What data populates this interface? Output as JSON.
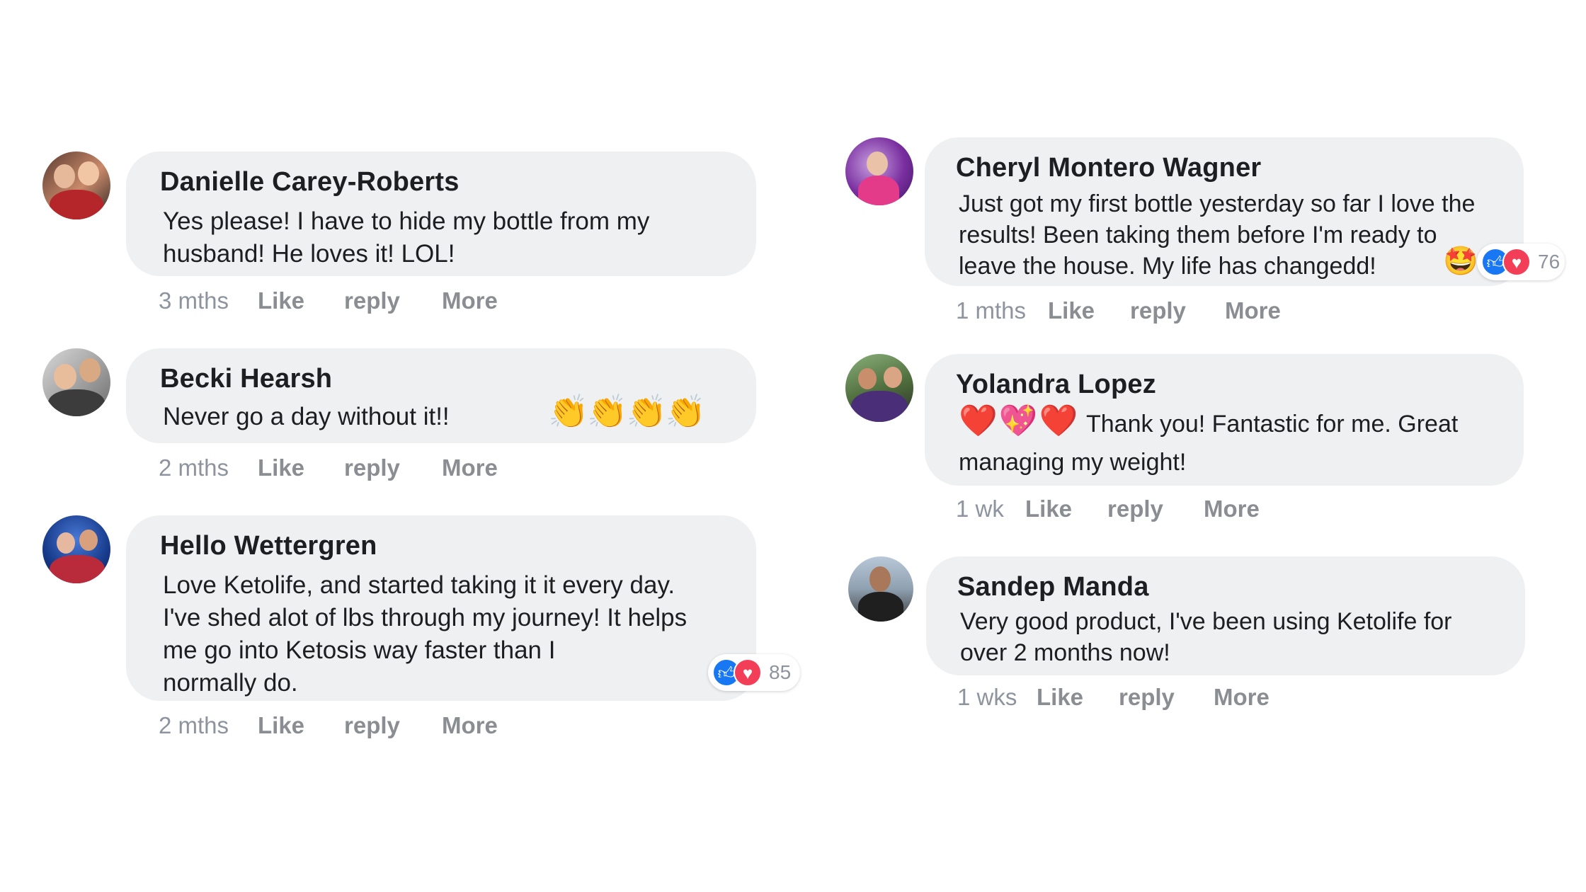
{
  "comments": [
    {
      "author": "Danielle Carey-Roberts",
      "lines": [
        "Yes please! I have to hide my bottle from my",
        "husband! He loves it! LOL!"
      ],
      "time": "3 mths",
      "like": "Like",
      "reply": "reply",
      "more": "More"
    },
    {
      "author": "Becki Hearsh",
      "lines": [
        "Never go a day without it!!"
      ],
      "emoji": "👏👏👏👏",
      "time": "2 mths",
      "like": "Like",
      "reply": "reply",
      "more": "More"
    },
    {
      "author": "Hello Wettergren",
      "lines": [
        "Love Ketolife, and started taking it it every day.",
        "I've shed alot of lbs through my journey! It helps",
        "me go into Ketosis way faster than I",
        "normally do."
      ],
      "reaction_count": "85",
      "time": "2 mths",
      "like": "Like",
      "reply": "reply",
      "more": "More"
    },
    {
      "author": "Cheryl Montero Wagner",
      "lines": [
        "Just got my first bottle yesterday so far I love the",
        "results! Been taking them before I'm ready to",
        "leave the house. My life has changedd!"
      ],
      "reaction_count": "76",
      "time": "1 mths",
      "like": "Like",
      "reply": "reply",
      "more": "More"
    },
    {
      "author": "Yolandra Lopez",
      "lines": [
        "Thank you! Fantastic for me. Great",
        "managing my weight!"
      ],
      "emoji": "❤️💖❤️",
      "time": "1 wk",
      "like": "Like",
      "reply": "reply",
      "more": "More"
    },
    {
      "author": "Sandep Manda",
      "lines": [
        "Very good product, I've been using Ketolife for",
        "over 2 months now!"
      ],
      "time": "1 wks",
      "like": "Like",
      "reply": "reply",
      "more": "More"
    }
  ],
  "icons": {
    "like": "thumbs-up-icon",
    "love": "heart-icon"
  },
  "colors": {
    "bubble": "#eff0f2",
    "like_blue": "#1877f2",
    "love_red": "#f33e58",
    "meta_gray": "#8d949e"
  }
}
